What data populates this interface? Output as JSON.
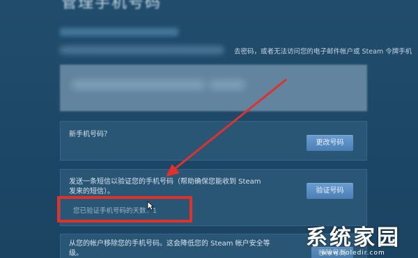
{
  "page": {
    "title": "管理手机号码",
    "intro_text": "去密码，或者无法访问您的电子邮件帐户或 Steam 令牌手机"
  },
  "sections": {
    "new_number": {
      "label": "新手机号码？",
      "button": "更改号码"
    },
    "verify": {
      "label": "发送一条短信以验证您的手机号码（帮助确保您能收到 Steam 发来的短信）。",
      "button": "验证号码",
      "verified_days_label": "您已验证手机号码的天数：1"
    },
    "remove": {
      "label": "从您的帐户移除您的手机号码。这会降低您的 Steam 帐户安全等级。",
      "button": "移除号码"
    }
  },
  "annotation": {
    "highlight_color": "#e0322b"
  },
  "watermark": {
    "main": "系统家园",
    "sub": "www.bоledir.com"
  }
}
